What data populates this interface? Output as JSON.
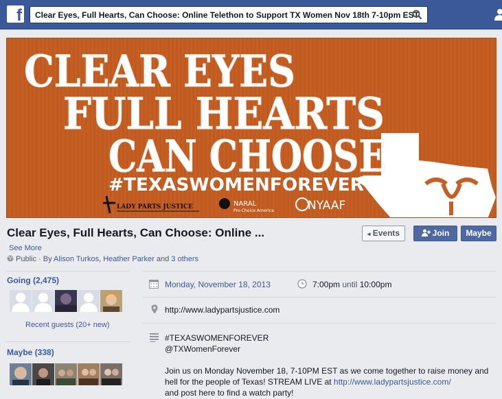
{
  "topbar": {
    "logo": "f",
    "search_value": "Clear Eyes, Full Hearts, Can Choose: Online Telethon to Support TX Women Nov 18th 7-10pm EST",
    "search_icon": "search-icon",
    "brand_color": "#3b5998"
  },
  "banner": {
    "line1": "CLEAR EYES",
    "line2": "FULL HEARTS",
    "line3": "CAN CHOOSE",
    "hashtag": "#TEXASWOMENFOREVER",
    "logo1": "LADY PARTS JUSTICE",
    "logo2_main": "NARAL",
    "logo2_sub": "Pro-Choice America",
    "logo3": "NYAAF",
    "bg_color": "#c65f23"
  },
  "event": {
    "title": "Clear Eyes, Full Hearts, Can Choose: Online ...",
    "buttons": {
      "events": "Events",
      "join": "Join",
      "maybe": "Maybe"
    },
    "see_more": "See More",
    "privacy": "Public",
    "by_prefix": "· By",
    "host1": "Alison Turkos",
    "host_sep": ",",
    "host2": "Heather Parker",
    "and_text": "and",
    "others": "3 others"
  },
  "going": {
    "title": "Going (2,475)",
    "recent": "Recent guests (20+ new)"
  },
  "maybe": {
    "title": "Maybe (338)"
  },
  "details": {
    "date": "Monday, November 18, 2013",
    "time_start": "7:00pm",
    "time_until": "until",
    "time_end": "10:00pm",
    "url": "http://www.ladypartsjustice.com",
    "desc_line1": "#TEXASWOMENFOREVER",
    "desc_line2": "@TXWomenForever",
    "desc_para": "Join us on Monday November 18, 7-10PM EST as we come together to raise money and hell for the people of Texas! STREAM LIVE at",
    "desc_link": "http://www.ladypartsjustice.com/",
    "desc_tail": "and post here to find a watch party!"
  }
}
